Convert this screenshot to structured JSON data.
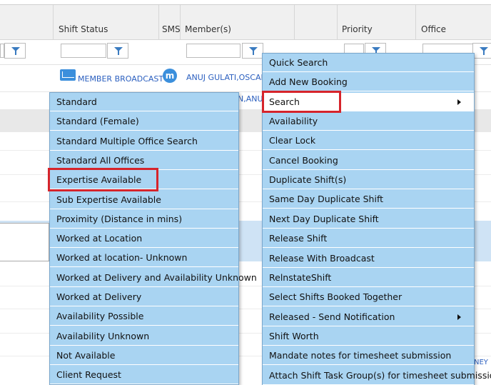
{
  "grid": {
    "columns": {
      "shift_status": "Shift Status",
      "sms": "SMS",
      "members": "Member(s)",
      "priority": "Priority",
      "office": "Office"
    },
    "row1": {
      "broadcast_label": "MEMBER BROADCAST",
      "members_text": "ANUJ GULATI,OSCAR JE",
      "members_text_2": "N,ANUJ",
      "badge_letter": "m"
    },
    "right_hint": "NEY"
  },
  "left_menu": {
    "items": [
      "Standard",
      "Standard (Female)",
      "Standard Multiple Office Search",
      "Standard All Offices",
      "Expertise Available",
      "Sub Expertise Available",
      "Proximity (Distance in mins)",
      "Worked at Location",
      "Worked at location- Unknown",
      "Worked at Delivery and Availability Unknown",
      "Worked at Delivery",
      "Availability Possible",
      "Availability Unknown",
      "Not Available",
      "Client Request"
    ],
    "highlighted": "Expertise Available"
  },
  "right_menu": {
    "items": [
      "Quick Search",
      "Add New Booking",
      "Search",
      "Availability",
      "Clear Lock",
      "Cancel Booking",
      "Duplicate Shift(s)",
      "Same Day Duplicate Shift",
      "Next Day Duplicate Shift",
      "Release Shift",
      "Release With Broadcast",
      "RelnstateShift",
      "Select Shifts Booked Together",
      "Released - Send Notification",
      "Shift Worth",
      "Mandate notes for timesheet submission",
      "Attach Shift Task Group(s) for timesheet submission"
    ],
    "active": "Search",
    "submenu_items": [
      "Search",
      "Released - Send Notification"
    ]
  },
  "colors": {
    "menu_bg": "#a9d4f2",
    "highlight_red": "#d6242b",
    "link_blue": "#2b5fbf"
  }
}
